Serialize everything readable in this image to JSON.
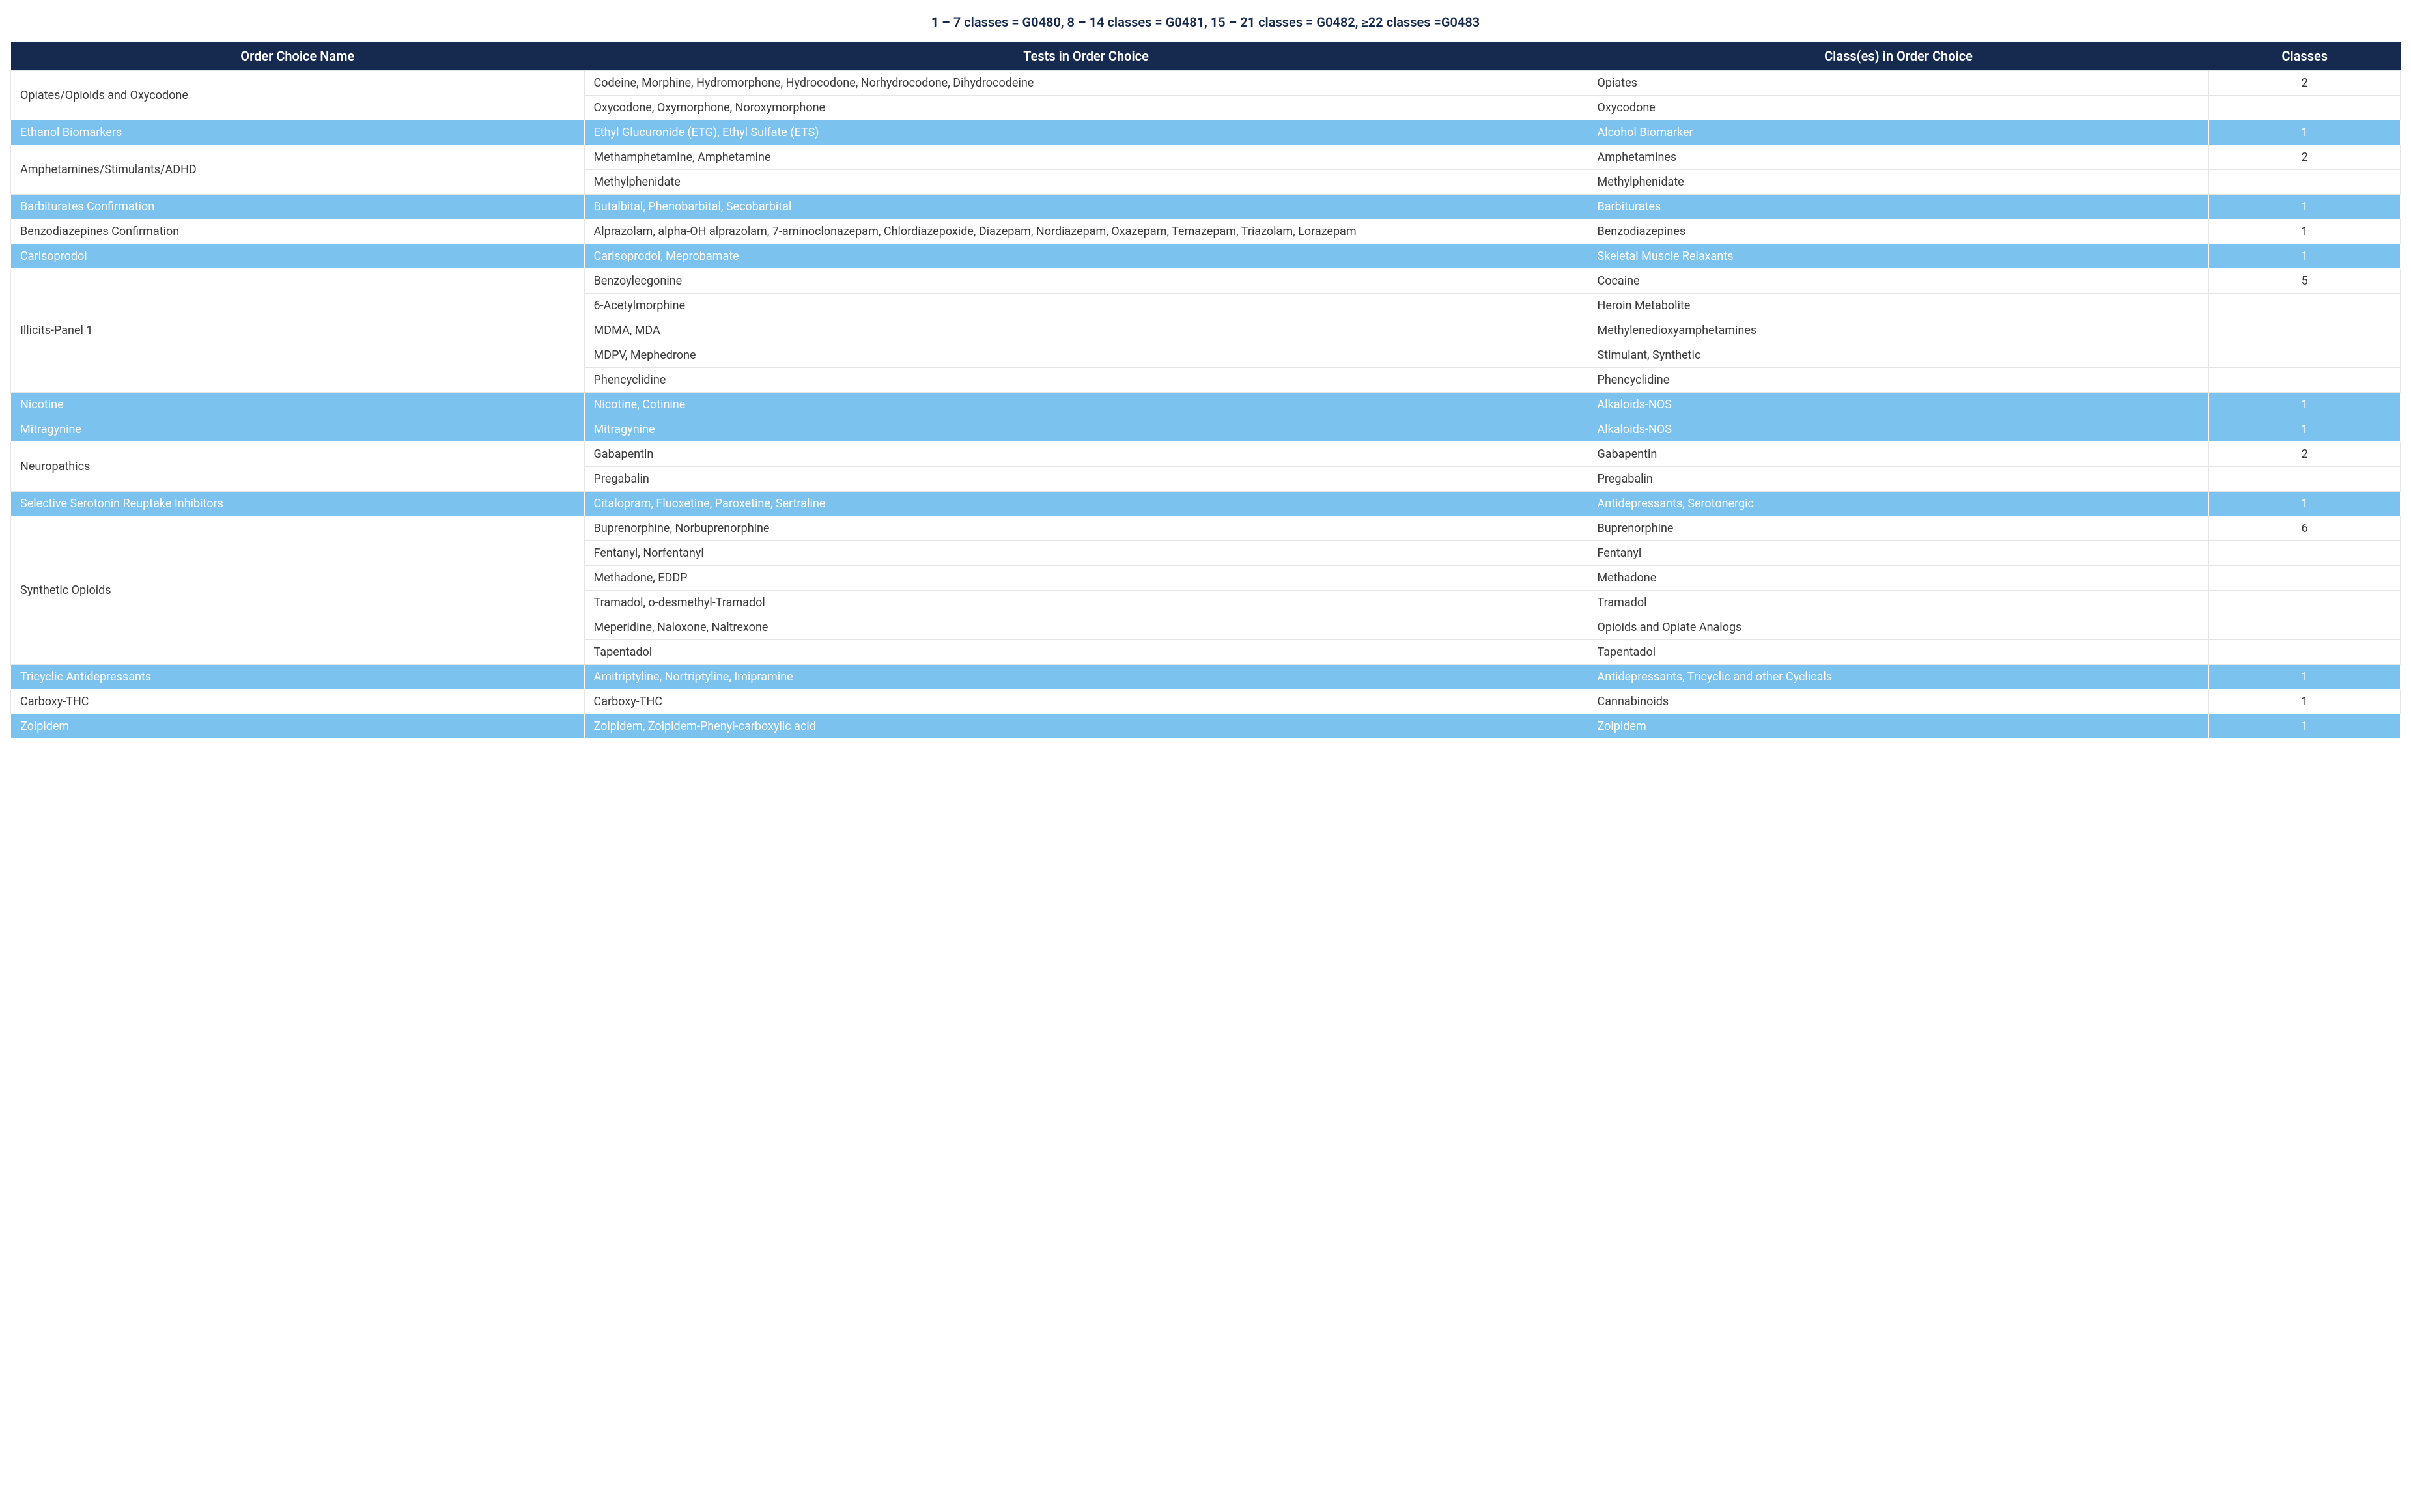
{
  "caption": "1 – 7 classes = G0480, 8 – 14 classes = G0481, 15 – 21 classes = G0482, ≥22 classes =G0483",
  "headers": {
    "c0": "Order Choice Name",
    "c1": "Tests in Order Choice",
    "c2": "Class(es) in Order Choice",
    "c3": "Classes"
  },
  "groups": [
    {
      "tone": "white",
      "name": "Opiates/Opioids and Oxycodone",
      "count": "2",
      "rows": [
        {
          "tests": "Codeine, Morphine, Hydromorphone, Hydrocodone, Norhydrocodone, Dihydrocodeine",
          "cls": "Opiates"
        },
        {
          "tests": "Oxycodone, Oxymorphone, Noroxymorphone",
          "cls": "Oxycodone"
        }
      ]
    },
    {
      "tone": "blue",
      "name": "Ethanol Biomarkers",
      "count": "1",
      "rows": [
        {
          "tests": "Ethyl Glucuronide (ETG), Ethyl Sulfate (ETS)",
          "cls": "Alcohol Biomarker"
        }
      ]
    },
    {
      "tone": "white",
      "name": "Amphetamines/Stimulants/ADHD",
      "count": "2",
      "rows": [
        {
          "tests": "Methamphetamine, Amphetamine",
          "cls": "Amphetamines"
        },
        {
          "tests": "Methylphenidate",
          "cls": "Methylphenidate"
        }
      ]
    },
    {
      "tone": "blue",
      "name": "Barbiturates Confirmation",
      "count": "1",
      "rows": [
        {
          "tests": "Butalbital, Phenobarbital, Secobarbital",
          "cls": "Barbiturates"
        }
      ]
    },
    {
      "tone": "white",
      "name": "Benzodiazepines Confirmation",
      "count": "1",
      "rows": [
        {
          "tests": "Alprazolam, alpha-OH alprazolam, 7-aminoclonazepam, Chlordiazepoxide, Diazepam, Nordiazepam, Oxazepam, Temazepam, Triazolam, Lorazepam",
          "cls": "Benzodiazepines"
        }
      ]
    },
    {
      "tone": "blue",
      "name": "Carisoprodol",
      "count": "1",
      "rows": [
        {
          "tests": "Carisoprodol, Meprobamate",
          "cls": "Skeletal Muscle Relaxants"
        }
      ]
    },
    {
      "tone": "white",
      "name": "Illicits-Panel 1",
      "count": "5",
      "rows": [
        {
          "tests": "Benzoylecgonine",
          "cls": "Cocaine"
        },
        {
          "tests": "6-Acetylmorphine",
          "cls": "Heroin Metabolite"
        },
        {
          "tests": "MDMA, MDA",
          "cls": "Methylenedioxyamphetamines"
        },
        {
          "tests": "MDPV, Mephedrone",
          "cls": "Stimulant, Synthetic"
        },
        {
          "tests": "Phencyclidine",
          "cls": "Phencyclidine"
        }
      ]
    },
    {
      "tone": "blue",
      "name": "Nicotine",
      "count": "1",
      "rows": [
        {
          "tests": "Nicotine, Cotinine",
          "cls": "Alkaloids-NOS"
        }
      ]
    },
    {
      "tone": "blue",
      "name": "Mitragynine",
      "count": "1",
      "rows": [
        {
          "tests": "Mitragynine",
          "cls": "Alkaloids-NOS"
        }
      ]
    },
    {
      "tone": "white",
      "name": "Neuropathics",
      "count": "2",
      "rows": [
        {
          "tests": "Gabapentin",
          "cls": "Gabapentin"
        },
        {
          "tests": "Pregabalin",
          "cls": "Pregabalin"
        }
      ]
    },
    {
      "tone": "blue",
      "name": "Selective Serotonin Reuptake Inhibitors",
      "count": "1",
      "rows": [
        {
          "tests": "Citalopram, Fluoxetine, Paroxetine, Sertraline",
          "cls": "Antidepressants, Serotonergic"
        }
      ]
    },
    {
      "tone": "white",
      "name": "Synthetic Opioids",
      "count": "6",
      "rows": [
        {
          "tests": "Buprenorphine, Norbuprenorphine",
          "cls": "Buprenorphine"
        },
        {
          "tests": "Fentanyl, Norfentanyl",
          "cls": "Fentanyl"
        },
        {
          "tests": "Methadone, EDDP",
          "cls": "Methadone"
        },
        {
          "tests": "Tramadol, o-desmethyl-Tramadol",
          "cls": "Tramadol"
        },
        {
          "tests": "Meperidine, Naloxone, Naltrexone",
          "cls": "Opioids and Opiate Analogs"
        },
        {
          "tests": "Tapentadol",
          "cls": "Tapentadol"
        }
      ]
    },
    {
      "tone": "blue",
      "name": "Tricyclic Antidepressants",
      "count": "1",
      "rows": [
        {
          "tests": "Amitriptyline, Nortriptyline, Imipramine",
          "cls": "Antidepressants, Tricyclic and other Cyclicals"
        }
      ]
    },
    {
      "tone": "white",
      "name": "Carboxy-THC",
      "count": "1",
      "rows": [
        {
          "tests": "Carboxy-THC",
          "cls": "Cannabinoids"
        }
      ]
    },
    {
      "tone": "blue",
      "name": "Zolpidem",
      "count": "1",
      "rows": [
        {
          "tests": "Zolpidem, Zolpidem-Phenyl-carboxylic acid",
          "cls": "Zolpidem"
        }
      ]
    }
  ]
}
